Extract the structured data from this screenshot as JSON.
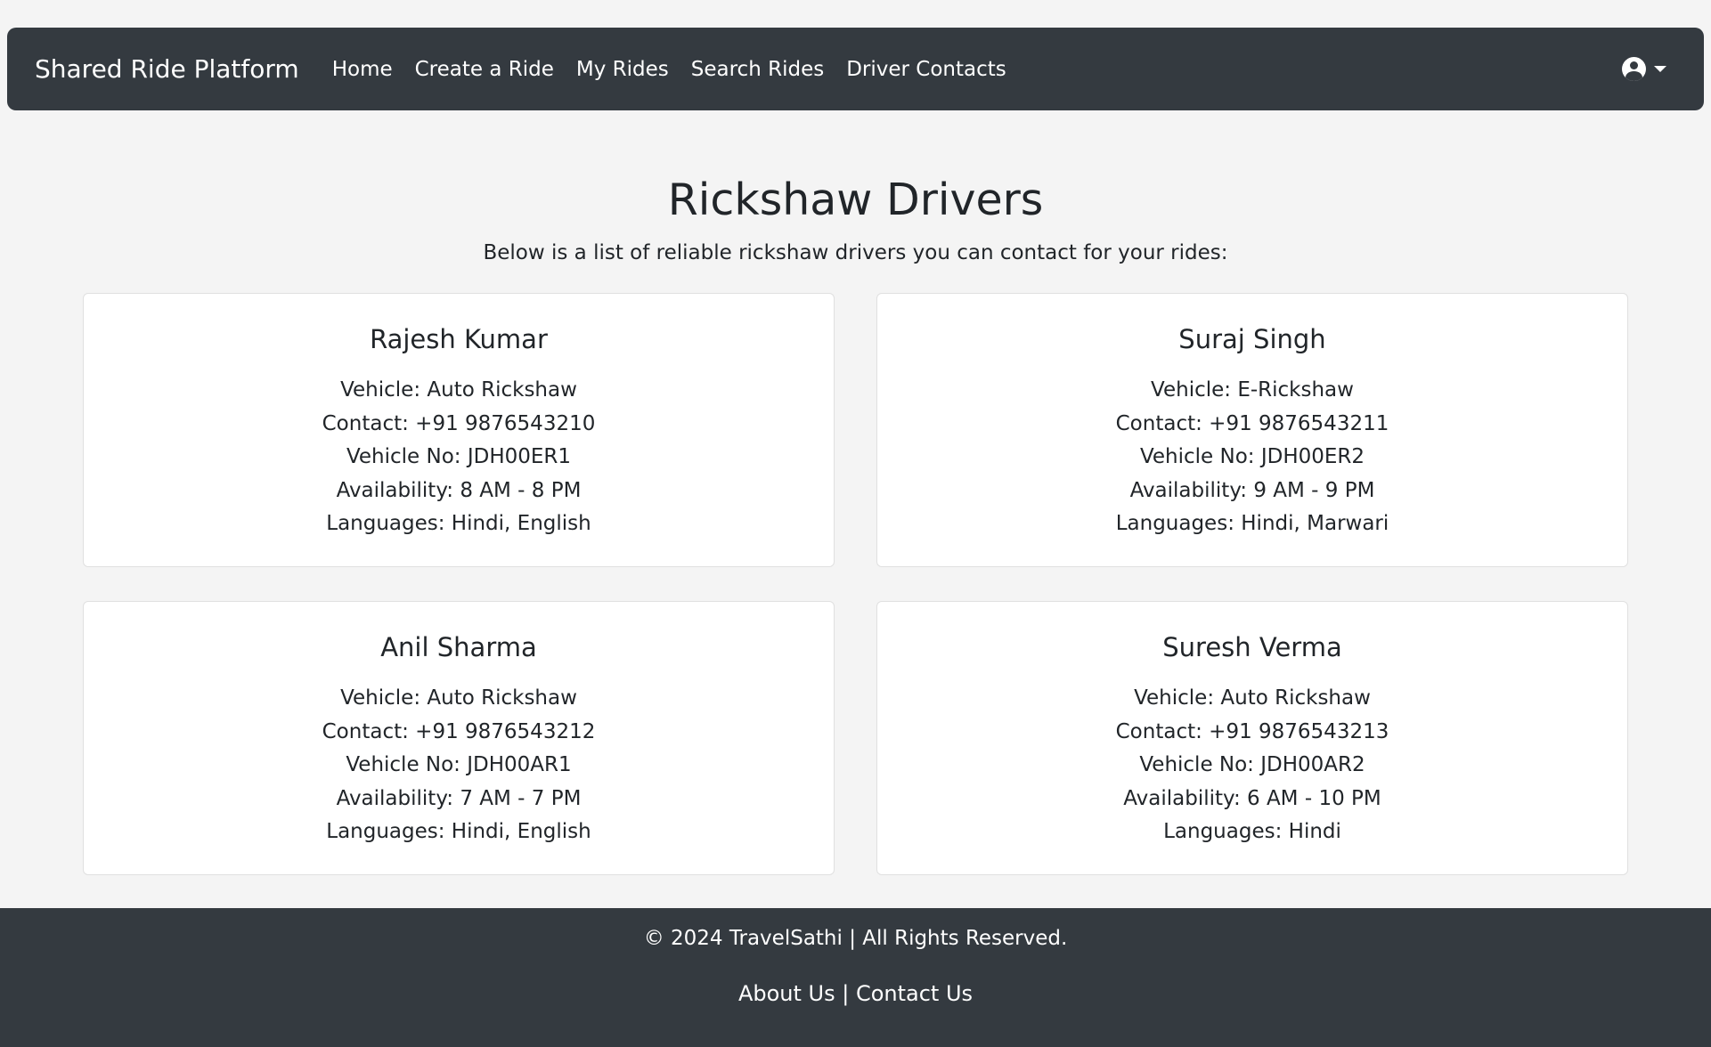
{
  "navbar": {
    "brand": "Shared Ride Platform",
    "links": [
      "Home",
      "Create a Ride",
      "My Rides",
      "Search Rides",
      "Driver Contacts"
    ],
    "user_icon": "user-circle-icon",
    "caret_icon": "caret-down-icon"
  },
  "main": {
    "title": "Rickshaw Drivers",
    "intro": "Below is a list of reliable rickshaw drivers you can contact for your rides:",
    "drivers": [
      {
        "name": "Rajesh Kumar",
        "vehicle": "Vehicle: Auto Rickshaw",
        "contact": "Contact: +91 9876543210",
        "vehicle_no": "Vehicle No: JDH00ER1",
        "availability": "Availability: 8 AM - 8 PM",
        "languages": "Languages: Hindi, English"
      },
      {
        "name": "Suraj Singh",
        "vehicle": "Vehicle: E-Rickshaw",
        "contact": "Contact: +91 9876543211",
        "vehicle_no": "Vehicle No: JDH00ER2",
        "availability": "Availability: 9 AM - 9 PM",
        "languages": "Languages: Hindi, Marwari"
      },
      {
        "name": "Anil Sharma",
        "vehicle": "Vehicle: Auto Rickshaw",
        "contact": "Contact: +91 9876543212",
        "vehicle_no": "Vehicle No: JDH00AR1",
        "availability": "Availability: 7 AM - 7 PM",
        "languages": "Languages: Hindi, English"
      },
      {
        "name": "Suresh Verma",
        "vehicle": "Vehicle: Auto Rickshaw",
        "contact": "Contact: +91 9876543213",
        "vehicle_no": "Vehicle No: JDH00AR2",
        "availability": "Availability: 6 AM - 10 PM",
        "languages": "Languages: Hindi"
      }
    ]
  },
  "footer": {
    "copyright": "© 2024 TravelSathi | All Rights Reserved.",
    "about": "About Us",
    "separator": "|",
    "contact": "Contact Us"
  },
  "colors": {
    "navbar_bg": "#343a40",
    "page_bg": "#f4f4f4",
    "card_bg": "#ffffff",
    "text": "#212529"
  }
}
